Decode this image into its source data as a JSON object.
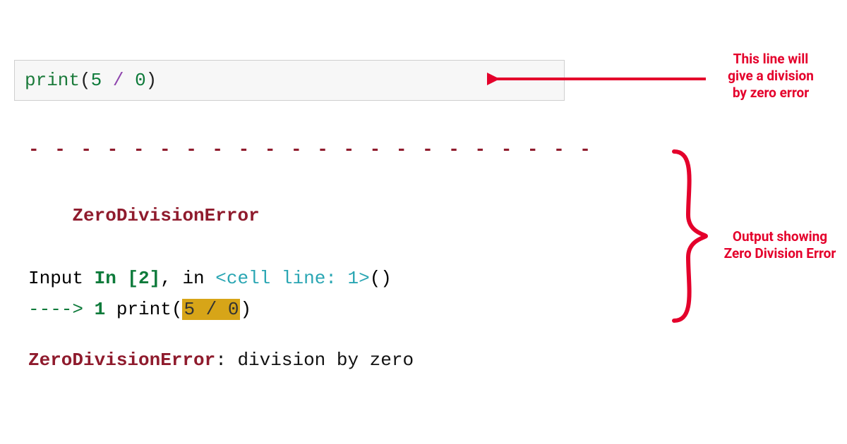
{
  "code_cell": {
    "func": "print",
    "lparen": "(",
    "num1": "5",
    "space1": " ",
    "op": "/",
    "space2": " ",
    "num2": "0",
    "rparen": ")"
  },
  "output": {
    "dashes": "- - - - - - - - - - - - - - - - - - - - - - - - - - - - - - - - - - - - - - -",
    "error_name": "ZeroDivisionError",
    "input_label": "Input ",
    "in_bracket": "In [2]",
    "comma_in": ", in ",
    "cell_line": "<cell line: 1>",
    "trailing_paren": "()",
    "arrow": "----> ",
    "line_no": "1 ",
    "p_func": "print",
    "p_lparen": "(",
    "highlight": "5 / 0",
    "p_rparen": ")",
    "final_error": "ZeroDivisionError",
    "final_msg": ": division by zero"
  },
  "annotations": {
    "a1_line1": "This line will",
    "a1_line2": "give a division",
    "a1_line3": "by zero error",
    "a2_line1": "Output showing",
    "a2_line2": "Zero Division Error"
  }
}
